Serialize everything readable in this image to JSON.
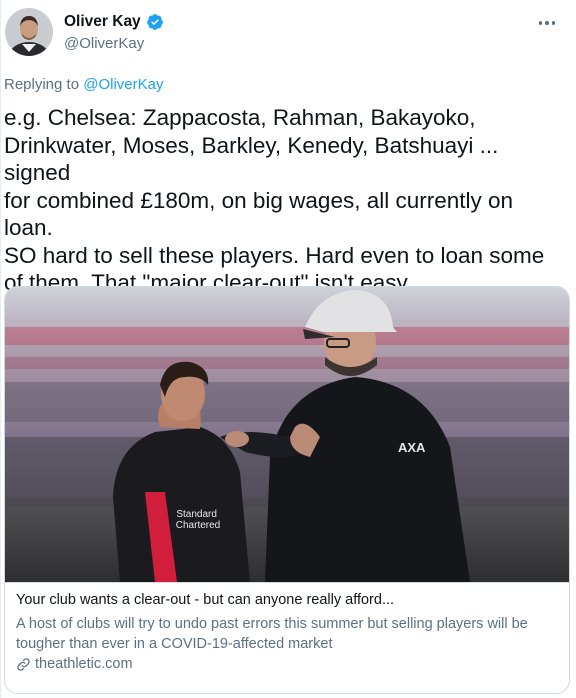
{
  "author": {
    "display_name": "Oliver Kay",
    "handle": "@OliverKay",
    "verified": true,
    "avatar": "avatar-photo"
  },
  "reply": {
    "prefix": "Replying to",
    "to": "@OliverKay"
  },
  "tweet": {
    "text": "e.g. Chelsea: Zappacosta, Rahman, Bakayoko,\nDrinkwater, Moses, Barkley, Kenedy, Batshuayi ... signed\nfor combined £180m, on big wages, all currently on\nloan.\nSO hard to sell these players. Hard even to loan some\nof them. That \"major clear-out\" isn't easy"
  },
  "card": {
    "image": "photo-two-men-on-football-pitch",
    "title": "Your club wants a clear-out - but can anyone really afford...",
    "description": "A host of clubs will try to undo past errors this summer but selling players will be tougher than ever in a COVID-19-affected market",
    "domain": "theathletic.com",
    "shirt_sponsor": "Standard\nChartered",
    "jacket_logo": "AXA"
  },
  "icons": {
    "verified": "verified-badge-icon",
    "more": "more-dots-icon",
    "link": "link-icon"
  },
  "colors": {
    "accent": "#1da1f2",
    "secondary_text": "#5b7083",
    "border": "#cfd9de"
  }
}
